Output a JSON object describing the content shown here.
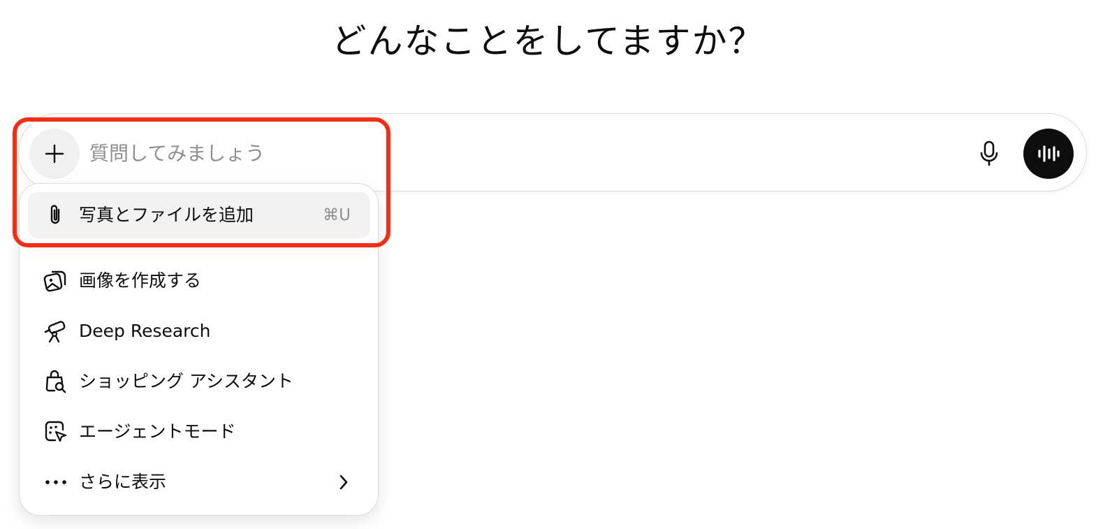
{
  "heading": "どんなことをしてますか？",
  "composer": {
    "placeholder": "質問してみましょう",
    "plus_icon": "plus-icon",
    "mic_icon": "microphone-icon",
    "voice_icon": "voice-waveform-icon"
  },
  "menu": {
    "items": [
      {
        "label": "写真とファイルを追加",
        "shortcut": "⌘U",
        "icon": "paperclip-icon",
        "active": true
      },
      {
        "label": "画像を作成する",
        "icon": "image-create-icon"
      },
      {
        "label": "Deep Research",
        "icon": "telescope-icon"
      },
      {
        "label": "ショッピング アシスタント",
        "icon": "shopping-bag-search-icon"
      },
      {
        "label": "エージェントモード",
        "icon": "agent-cursor-icon"
      },
      {
        "label": "さらに表示",
        "icon": "more-dots-icon",
        "chevron_icon": "chevron-right-icon"
      }
    ]
  },
  "colors": {
    "highlight": "#ff2a12",
    "voice_button": "#0d0d0d",
    "active_row": "#f2f2f2",
    "placeholder": "#8f8f8f"
  }
}
